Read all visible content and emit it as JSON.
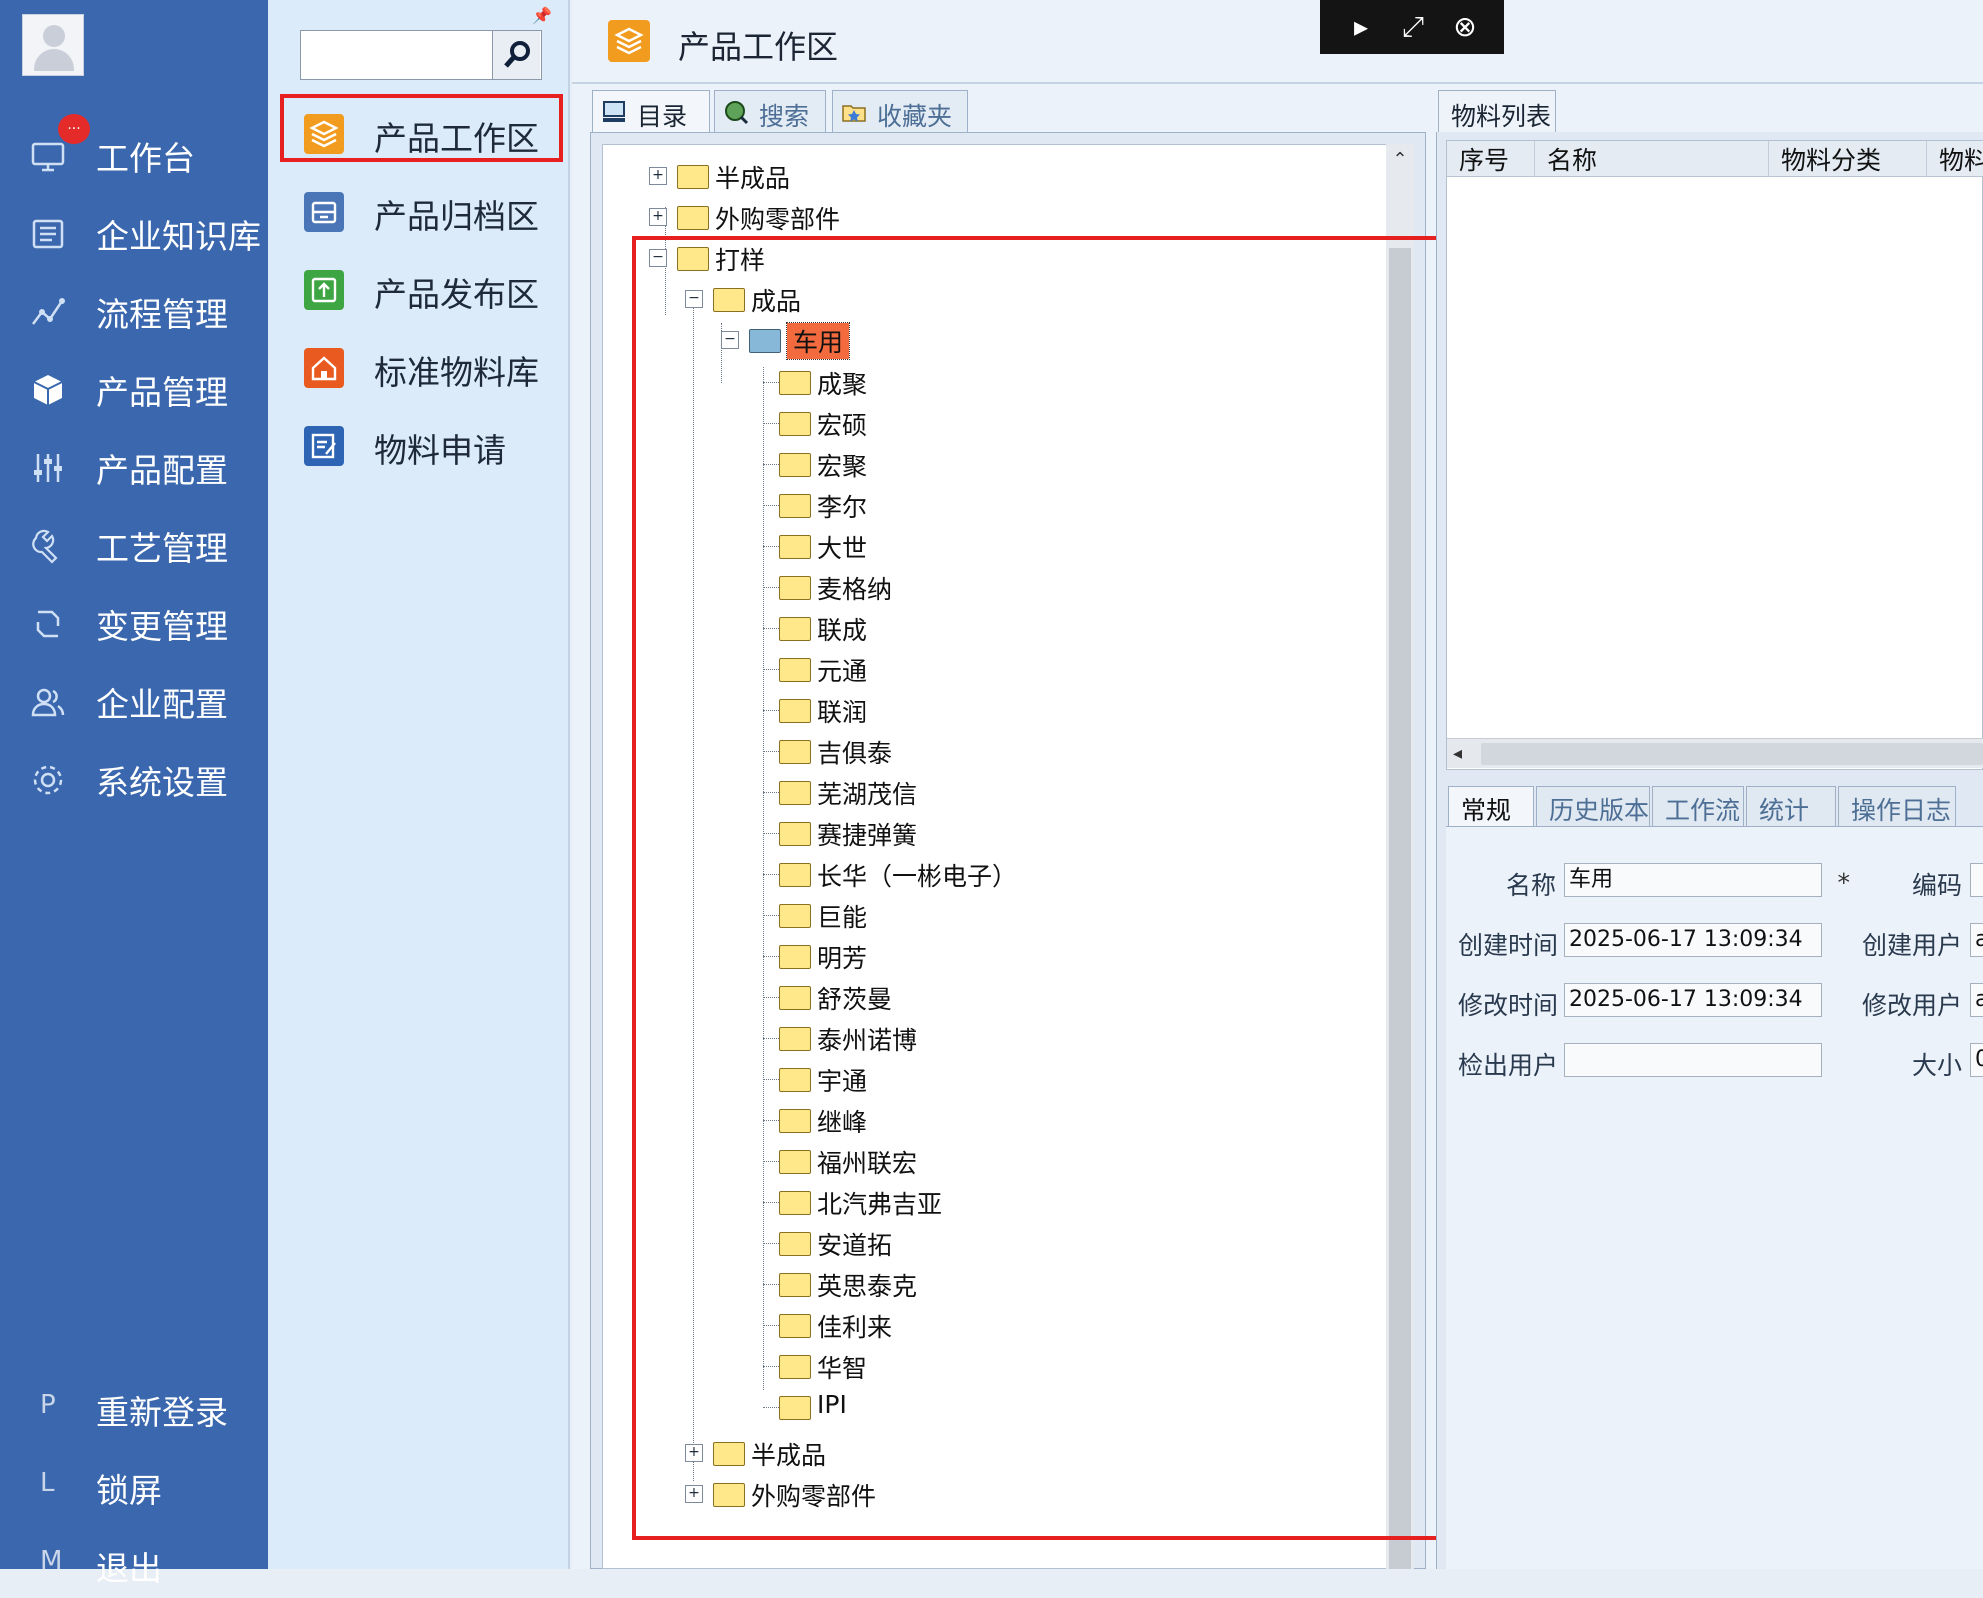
{
  "nav": {
    "badge": "...",
    "items": [
      {
        "label": "工作台",
        "icon": "monitor-icon"
      },
      {
        "label": "企业知识库",
        "icon": "book-icon"
      },
      {
        "label": "流程管理",
        "icon": "flow-icon"
      },
      {
        "label": "产品管理",
        "icon": "cube-icon"
      },
      {
        "label": "产品配置",
        "icon": "sliders-icon"
      },
      {
        "label": "工艺管理",
        "icon": "wrench-icon"
      },
      {
        "label": "变更管理",
        "icon": "change-icon"
      },
      {
        "label": "企业配置",
        "icon": "users-icon"
      },
      {
        "label": "系统设置",
        "icon": "gear-icon"
      }
    ],
    "bottom": [
      {
        "key": "P",
        "label": "重新登录"
      },
      {
        "key": "L",
        "label": "锁屏"
      },
      {
        "key": "M",
        "label": "退出"
      }
    ]
  },
  "sub": {
    "search_placeholder": "",
    "items": [
      {
        "label": "产品工作区",
        "color": "#f29c1f"
      },
      {
        "label": "产品归档区",
        "color": "#4a76b8"
      },
      {
        "label": "产品发布区",
        "color": "#3da542"
      },
      {
        "label": "标准物料库",
        "color": "#e95a20"
      },
      {
        "label": "物料申请",
        "color": "#2e64b4"
      }
    ]
  },
  "main": {
    "title": "产品工作区"
  },
  "tree_tabs": [
    {
      "label": "目录",
      "icon": "computer-icon"
    },
    {
      "label": "搜索",
      "icon": "globe-search-icon"
    },
    {
      "label": "收藏夹",
      "icon": "favorites-folder-icon"
    }
  ],
  "tree": {
    "top": [
      {
        "label": "半成品",
        "toggle": "+"
      },
      {
        "label": "外购零部件",
        "toggle": "+"
      },
      {
        "label": "打样",
        "toggle": "−"
      }
    ],
    "level1": {
      "label": "成品",
      "toggle": "−"
    },
    "level2": {
      "label": "车用",
      "toggle": "−"
    },
    "children": [
      "成聚",
      "宏硕",
      "宏聚",
      "李尔",
      "大世",
      "麦格纳",
      "联成",
      "元通",
      "联润",
      "吉俱泰",
      "芜湖茂信",
      "赛捷弹簧",
      "长华（一彬电子）",
      "巨能",
      "明芳",
      "舒茨曼",
      "泰州诺博",
      "宇通",
      "继峰",
      "福州联宏",
      "北汽弗吉亚",
      "安道拓",
      "英思泰克",
      "佳利来",
      "华智",
      "IPI"
    ],
    "tail": [
      {
        "label": "半成品",
        "toggle": "+"
      },
      {
        "label": "外购零部件",
        "toggle": "+"
      }
    ]
  },
  "right": {
    "tab": "物料列表",
    "columns": [
      "序号",
      "名称",
      "物料分类",
      "物料"
    ],
    "detail_tabs": [
      "常规",
      "历史版本",
      "工作流",
      "统计",
      "操作日志"
    ],
    "fields": {
      "name_label": "名称",
      "name_value": "车用",
      "required": "*",
      "code_label": "编码",
      "ctime_label": "创建时间",
      "ctime_value": "2025-06-17 13:09:34",
      "cuser_label": "创建用户",
      "cuser_value": "a",
      "mtime_label": "修改时间",
      "mtime_value": "2025-06-17 13:09:34",
      "muser_label": "修改用户",
      "muser_value": "a",
      "checkout_label": "检出用户",
      "checkout_value": "",
      "size_label": "大小",
      "size_value": "0"
    }
  }
}
